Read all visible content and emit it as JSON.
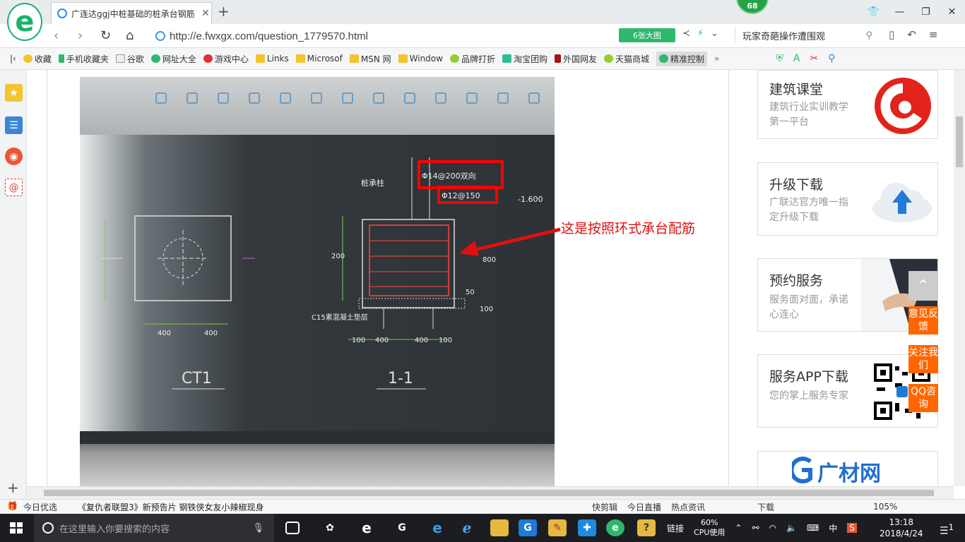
{
  "browser": {
    "tab_title": "广连达ggj中桩基础的桩承台钢筋",
    "badge": "68",
    "url": "http://e.fwxgx.com/question_1779570.html",
    "image_button": "6张大图",
    "search_text": "玩家奇葩操作遭围观"
  },
  "bookmarks": [
    "收藏",
    "手机收藏夹",
    "谷歌",
    "网址大全",
    "游戏中心",
    "Links",
    "Microsof",
    "MSN 网",
    "Window",
    "品牌打折",
    "淘宝团购",
    "外国网友",
    "天猫商城",
    "精准控制"
  ],
  "annotation": "这是按照环式承台配筋",
  "cad": {
    "labels": [
      "CT1",
      "1-1",
      "桩承柱",
      "Φ14@200双向",
      "Φ12@150",
      "-1.600",
      "400",
      "400",
      "100",
      "400",
      "400",
      "100",
      "200",
      "800",
      "50",
      "100",
      "C15素混凝土垫层"
    ]
  },
  "sidebar_cards": [
    {
      "title": "建筑课堂",
      "sub": "建筑行业实训教学第一平台"
    },
    {
      "title": "升级下载",
      "sub": "广联达官方唯一指定升级下载"
    },
    {
      "title": "预约服务",
      "sub": "服务面对面，承诺心连心"
    },
    {
      "title": "服务APP下载",
      "sub": "您的掌上服务专家"
    }
  ],
  "gcw_logo": "广材网",
  "float_buttons": [
    "意见反馈",
    "关注我们",
    "QQ咨询"
  ],
  "statusbar": {
    "left": "今日优选",
    "news": "《复仇者联盟3》新预告片 钢铁侠女友小辣椒现身",
    "right": [
      "快剪辑",
      "今日直播",
      "热点资讯",
      "下载",
      "105%"
    ]
  },
  "taskbar": {
    "search_placeholder": "在这里输入你要搜索的内容",
    "link_label": "链接",
    "cpu_percent": "60%",
    "cpu_label": "CPU使用",
    "ime": "中",
    "time": "13:18",
    "date": "2018/4/24",
    "notif_count": "1"
  }
}
